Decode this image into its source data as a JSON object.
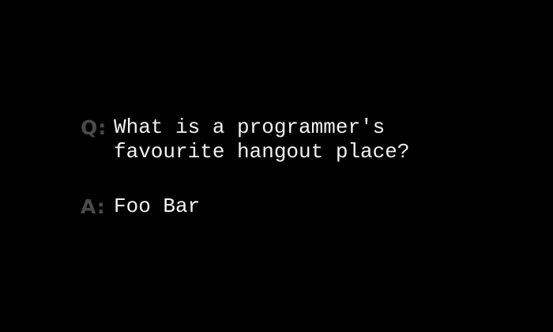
{
  "question": {
    "label": "Q:",
    "lines": [
      "What is a programmer's",
      "favourite hangout place?"
    ]
  },
  "answer": {
    "label": "A:",
    "text": "Foo Bar"
  }
}
